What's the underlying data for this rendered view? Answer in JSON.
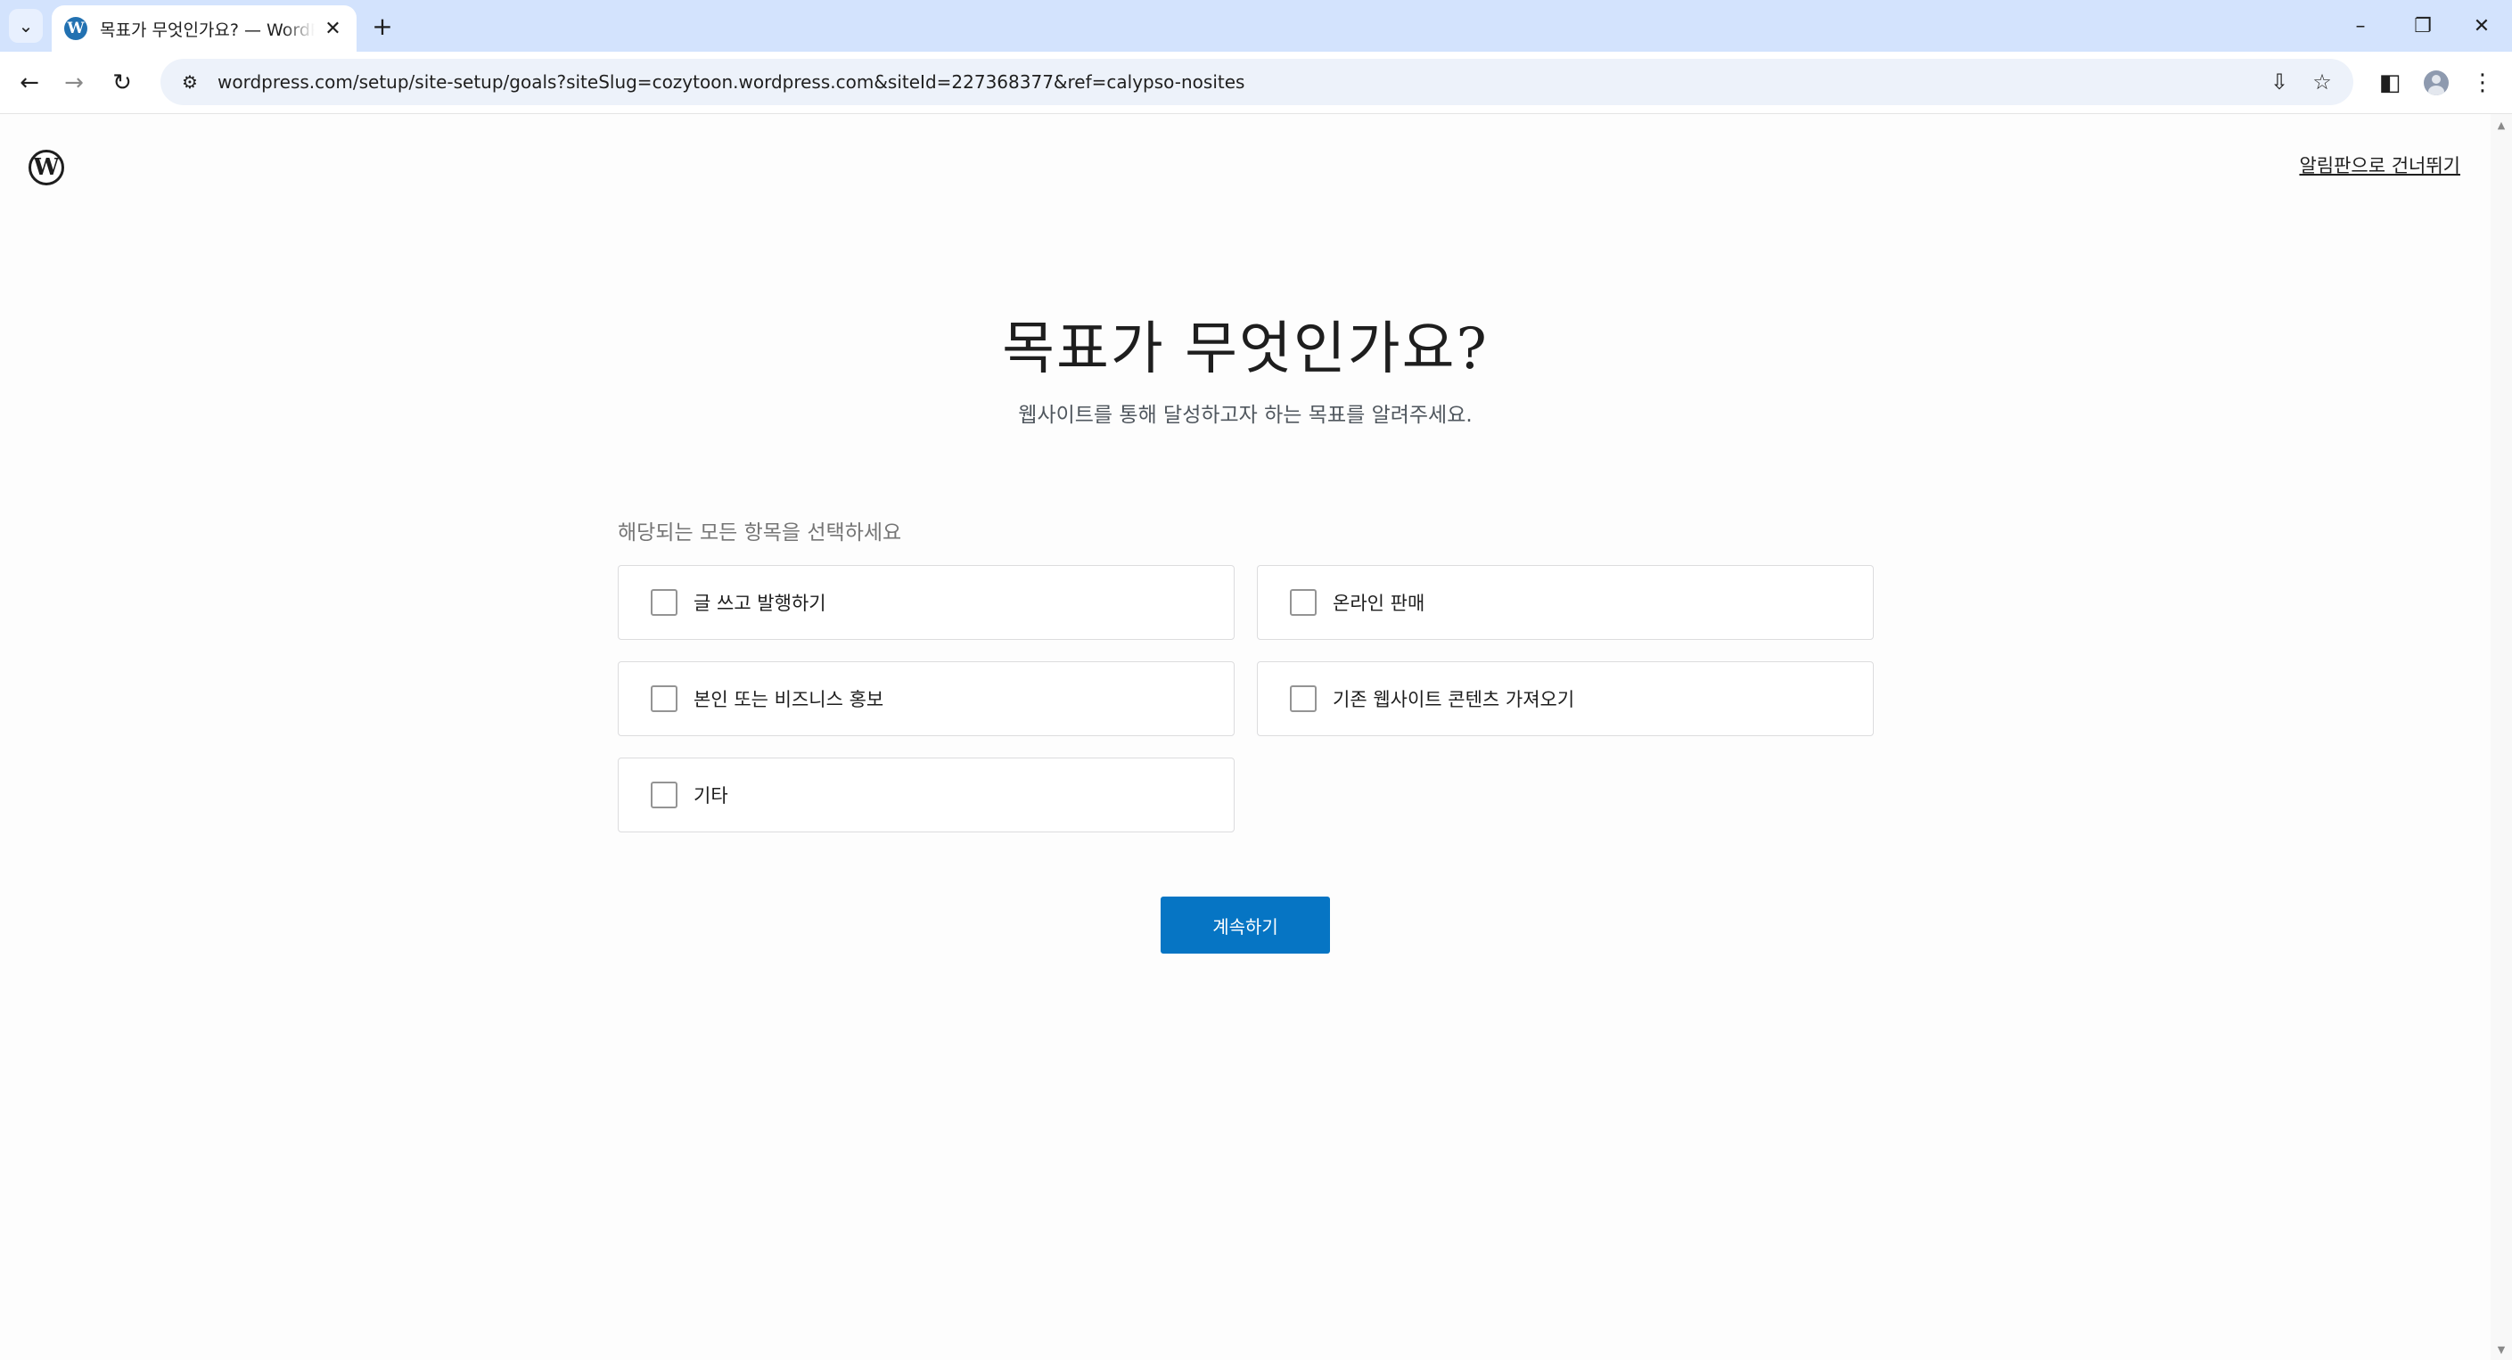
{
  "browser": {
    "tab": {
      "title": "목표가 무엇인가요? — WordPress.com",
      "favicon": "wordpress-icon"
    },
    "url": "wordpress.com/setup/site-setup/goals?siteSlug=cozytoon.wordpress.com&siteId=227368377&ref=calypso-nosites",
    "icons": {
      "tab_list": "⌄",
      "close_tab": "✕",
      "new_tab": "+",
      "minimize": "–",
      "restore": "❐",
      "close_window": "✕",
      "back": "←",
      "forward": "→",
      "reload": "↻",
      "site_info": "⚙",
      "install": "⇩",
      "bookmark": "☆",
      "side_panel": "◧",
      "menu": "⋮"
    }
  },
  "page": {
    "logo_letter": "W",
    "skip_link": "알림판으로 건너뛰기",
    "title": "목표가 무엇인가요?",
    "subtitle": "웹사이트를 통해 달성하고자 하는 목표를 알려주세요.",
    "select_label": "해당되는 모든 항목을 선택하세요",
    "goals": [
      {
        "label": "글 쓰고 발행하기",
        "checked": false
      },
      {
        "label": "온라인 판매",
        "checked": false
      },
      {
        "label": "본인 또는 비즈니스 홍보",
        "checked": false
      },
      {
        "label": "기존 웹사이트 콘텐츠 가져오기",
        "checked": false
      },
      {
        "label": "기타",
        "checked": false
      }
    ],
    "continue_button": "계속하기"
  },
  "colors": {
    "accent": "#0675c4",
    "tabbar": "#d3e3fd",
    "omnibox": "#edf2fa"
  }
}
